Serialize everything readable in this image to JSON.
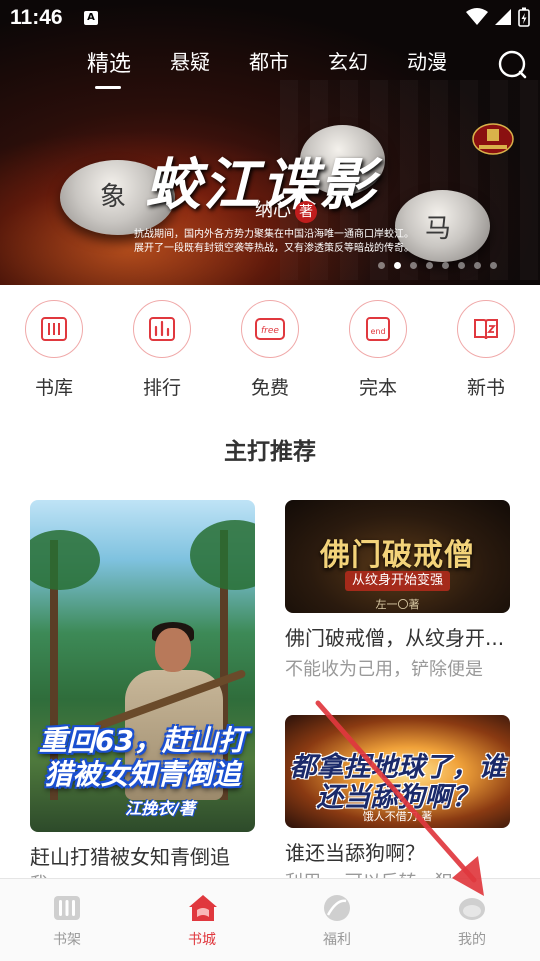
{
  "status_bar": {
    "time": "11:46",
    "sim_badge": "A"
  },
  "category_tabs": [
    {
      "label": "精选",
      "active": true
    },
    {
      "label": "悬疑",
      "active": false
    },
    {
      "label": "都市",
      "active": false
    },
    {
      "label": "玄幻",
      "active": false
    },
    {
      "label": "动漫",
      "active": false
    }
  ],
  "banner": {
    "title": "蛟江谍影",
    "author": "纳心",
    "author_suffix": "著",
    "description": "抗战期间，国内外各方势力聚集在中国沿海唯一通商口岸蛟江。展开了一段既有封锁空袭等热战，又有渗透策反等暗战的传奇。",
    "chess_glyphs": [
      "象",
      "马"
    ],
    "slide_count": 8,
    "active_slide": 1
  },
  "quick_entries": [
    {
      "label": "书库",
      "icon": "library-icon"
    },
    {
      "label": "排行",
      "icon": "ranking-icon"
    },
    {
      "label": "免费",
      "icon": "free-icon"
    },
    {
      "label": "完本",
      "icon": "completed-icon"
    },
    {
      "label": "新书",
      "icon": "new-book-icon"
    }
  ],
  "section": {
    "title": "主打推荐"
  },
  "books": {
    "main": {
      "cover_title": "重回63，赶山打猎被女知青倒追",
      "cover_author": "江挽衣/著",
      "title": "赶山打猎被女知青倒追",
      "desc": "我，… …"
    },
    "b1": {
      "cover_title": "佛门破戒僧",
      "cover_sub": "从纹身开始变强",
      "cover_author": "左一〇著",
      "title": "佛门破戒僧，从纹身开...",
      "desc": "不能收为己用，铲除便是"
    },
    "b2": {
      "cover_title": "都拿捏地球了，谁还当舔狗啊？",
      "cover_author": "饿人不借刀 著",
      "title": "谁还当舔狗啊？",
      "desc": "利用… 可以反转…犯"
    }
  },
  "bottom_nav": [
    {
      "label": "书架",
      "icon": "bookshelf-icon",
      "active": false
    },
    {
      "label": "书城",
      "icon": "bookstore-icon",
      "active": true
    },
    {
      "label": "福利",
      "icon": "welfare-icon",
      "active": false
    },
    {
      "label": "我的",
      "icon": "profile-icon",
      "active": false
    }
  ],
  "colors": {
    "accent": "#e0383e",
    "entry_border": "#f0a9a9",
    "text_primary": "#333333",
    "text_secondary": "#999999",
    "overlay_arrow": "#e0383e"
  }
}
